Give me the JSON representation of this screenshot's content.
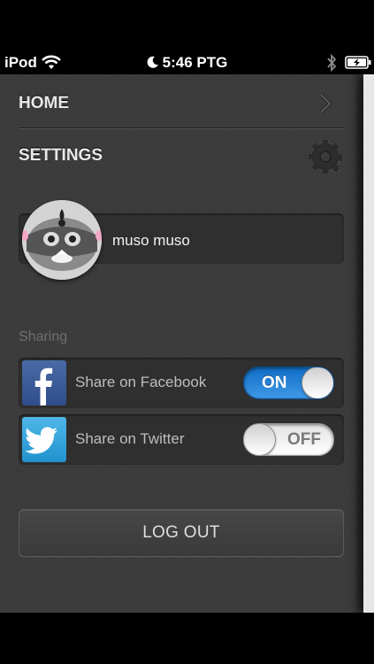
{
  "status_bar": {
    "carrier": "iPod",
    "time": "5:46 PTG",
    "icons": [
      "wifi-icon",
      "moon-icon",
      "bluetooth-icon",
      "battery-charging-icon"
    ]
  },
  "menu": {
    "home_label": "HOME",
    "settings_label": "SETTINGS",
    "icons": [
      "chevron-right-icon",
      "gear-icon"
    ]
  },
  "profile": {
    "name": "muso muso",
    "avatar": "raccoon-avatar"
  },
  "sharing": {
    "section_label": "Sharing",
    "facebook": {
      "label": "Share on Facebook",
      "toggle_text": "ON",
      "enabled": true,
      "icon": "facebook-icon",
      "color": "#3b5998"
    },
    "twitter": {
      "label": "Share on Twitter",
      "toggle_text": "OFF",
      "enabled": false,
      "icon": "twitter-icon",
      "color": "#2aa4df"
    }
  },
  "logout_label": "LOG OUT",
  "colors": {
    "background": "#3b3b3b",
    "toggle_on": "#1a7bd6"
  }
}
